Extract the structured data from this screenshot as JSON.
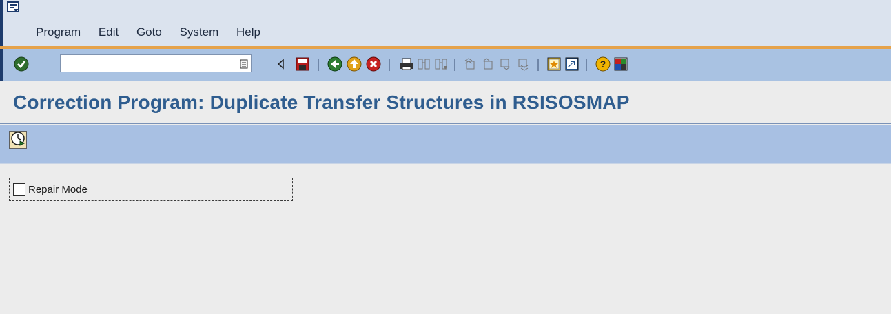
{
  "menu": {
    "items": [
      {
        "label": "Program"
      },
      {
        "label": "Edit"
      },
      {
        "label": "Goto"
      },
      {
        "label": "System"
      },
      {
        "label": "Help"
      }
    ]
  },
  "toolbar": {
    "command_field_value": "",
    "icons": [
      "enter-icon",
      "dropdown-icon",
      "back-arrow-icon",
      "save-icon",
      "back-icon",
      "exit-icon",
      "cancel-icon",
      "print-icon",
      "find-icon",
      "find-next-icon",
      "first-page-icon",
      "previous-page-icon",
      "next-page-icon",
      "last-page-icon",
      "new-session-icon",
      "shortcut-icon",
      "help-icon",
      "layout-menu-icon"
    ]
  },
  "page": {
    "title": "Correction Program: Duplicate Transfer Structures in RSISOSMAP"
  },
  "app_toolbar": {
    "execute_icon": "execute-icon"
  },
  "form": {
    "repair_mode_label": "Repair Mode",
    "repair_mode_checked": false
  },
  "colors": {
    "title": "#2f5d8f",
    "toolbar": "#a9c2e2",
    "accent": "#e5a24a",
    "menubar": "#dbe3ee"
  }
}
